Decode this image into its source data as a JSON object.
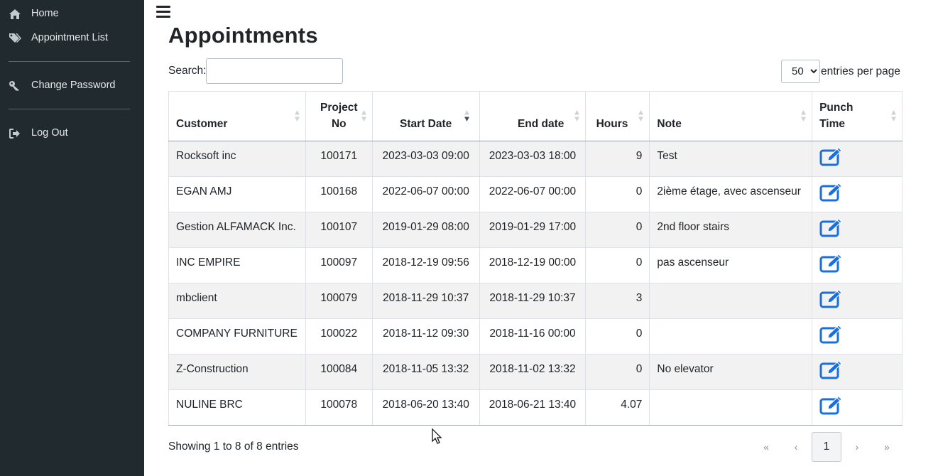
{
  "sidebar": {
    "items": [
      {
        "label": "Home",
        "icon": "home-icon"
      },
      {
        "label": "Appointment List",
        "icon": "tags-icon"
      },
      {
        "label": "Change Password",
        "icon": "key-icon"
      },
      {
        "label": "Log Out",
        "icon": "sign-out-icon"
      }
    ]
  },
  "page": {
    "title": "Appointments",
    "search_label": "Search:",
    "search_value": "",
    "per_page_value": "50",
    "per_page_label": "entries per page"
  },
  "table": {
    "headers": {
      "customer": "Customer",
      "project_no_1": "Project",
      "project_no_2": "No",
      "start_date": "Start Date",
      "end_date": "End date",
      "hours": "Hours",
      "note": "Note",
      "punch_time_1": "Punch",
      "punch_time_2": "Time"
    },
    "rows": [
      {
        "customer": "Rocksoft inc",
        "project_no": "100171",
        "start": "2023-03-03 09:00",
        "end": "2023-03-03 18:00",
        "hours": "9",
        "note": "Test"
      },
      {
        "customer": "EGAN AMJ",
        "project_no": "100168",
        "start": "2022-06-07 00:00",
        "end": "2022-06-07 00:00",
        "hours": "0",
        "note": "2ième étage, avec ascenseur"
      },
      {
        "customer": "Gestion ALFAMACK Inc.",
        "project_no": "100107",
        "start": "2019-01-29 08:00",
        "end": "2019-01-29 17:00",
        "hours": "0",
        "note": "2nd floor stairs"
      },
      {
        "customer": "INC EMPIRE",
        "project_no": "100097",
        "start": "2018-12-19 09:56",
        "end": "2018-12-19 00:00",
        "hours": "0",
        "note": "pas ascenseur"
      },
      {
        "customer": "mbclient",
        "project_no": "100079",
        "start": "2018-11-29 10:37",
        "end": "2018-11-29 10:37",
        "hours": "3",
        "note": ""
      },
      {
        "customer": "COMPANY FURNITURE",
        "project_no": "100022",
        "start": "2018-11-12 09:30",
        "end": "2018-11-16 00:00",
        "hours": "0",
        "note": ""
      },
      {
        "customer": "Z-Construction",
        "project_no": "100084",
        "start": "2018-11-05 13:32",
        "end": "2018-11-02 13:32",
        "hours": "0",
        "note": "No elevator"
      },
      {
        "customer": "NULINE BRC",
        "project_no": "100078",
        "start": "2018-06-20 13:40",
        "end": "2018-06-21 13:40",
        "hours": "4.07",
        "note": ""
      }
    ]
  },
  "footer": {
    "info": "Showing 1 to 8 of 8 entries",
    "pager": {
      "first": "«",
      "prev": "‹",
      "current": "1",
      "next": "›",
      "last": "»"
    }
  },
  "colors": {
    "sidebar_bg": "#212b2f",
    "edit_icon": "#1a6fe0",
    "row_stripe": "#f2f2f2"
  }
}
